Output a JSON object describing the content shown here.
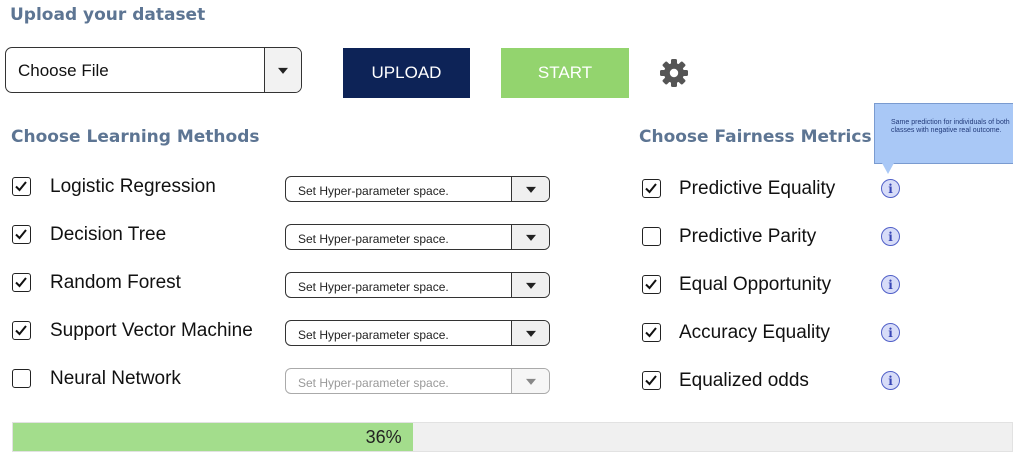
{
  "upload_section": {
    "heading": "Upload your dataset",
    "file_select_label": "Choose File",
    "upload_label": "UPLOAD",
    "start_label": "START"
  },
  "learning_methods": {
    "heading": "Choose Learning Methods",
    "hyperparam_placeholder": "Set Hyper-parameter space.",
    "items": [
      {
        "label": "Logistic Regression",
        "checked": true
      },
      {
        "label": "Decision Tree",
        "checked": true
      },
      {
        "label": "Random Forest",
        "checked": true
      },
      {
        "label": "Support Vector Machine",
        "checked": true
      },
      {
        "label": "Neural Network",
        "checked": false
      }
    ]
  },
  "fairness_metrics": {
    "heading": "Choose Fairness Metrics",
    "items": [
      {
        "label": "Predictive Equality",
        "checked": true
      },
      {
        "label": "Predictive Parity",
        "checked": false
      },
      {
        "label": "Equal Opportunity",
        "checked": true
      },
      {
        "label": "Accuracy Equality",
        "checked": true
      },
      {
        "label": "Equalized odds",
        "checked": true
      }
    ],
    "info_glyph": "i",
    "tooltip_text": "Same prediction for individuals of both classes with negative real outcome."
  },
  "progress": {
    "value_percent": 36,
    "label": "36%"
  },
  "icons": {
    "settings": "gear-icon",
    "info": "info-icon",
    "dropdown": "chevron-down-icon"
  },
  "colors": {
    "heading": "#5d7593",
    "upload_button": "#0d2357",
    "start_button": "#93d46e",
    "progress_fill": "#a3dd8c",
    "info_icon": "#5160c8",
    "tooltip_bg": "#a9c8f6"
  }
}
